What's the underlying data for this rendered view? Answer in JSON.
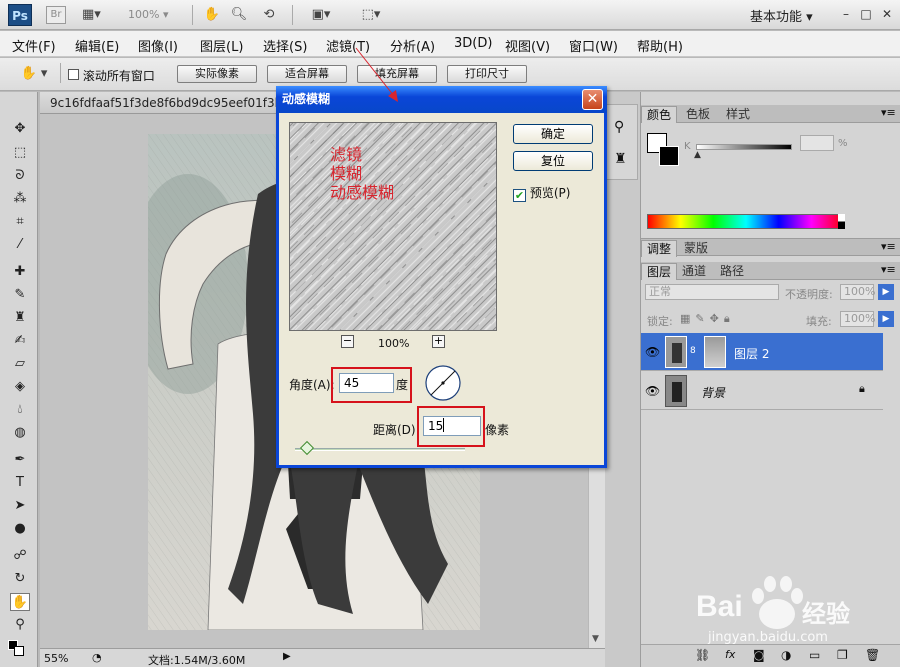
{
  "app": {
    "logo": "Ps",
    "bridge": "Br",
    "zoom_select": "100%",
    "workspace": "基本功能",
    "window_controls": [
      "–",
      "□",
      "✕"
    ]
  },
  "menu": [
    "文件(F)",
    "编辑(E)",
    "图像(I)",
    "图层(L)",
    "选择(S)",
    "滤镜(T)",
    "分析(A)",
    "3D(D)",
    "视图(V)",
    "窗口(W)",
    "帮助(H)"
  ],
  "options_bar": {
    "scroll_all_windows": "滚动所有窗口",
    "buttons": [
      "实际像素",
      "适合屏幕",
      "填充屏幕",
      "打印尺寸"
    ]
  },
  "document": {
    "tab_title": "9c16fdfaaf51f3de8f6bd9dc95eef01f3b29",
    "zoom": "55%",
    "doc_size": "文档:1.54M/3.60M"
  },
  "dialog": {
    "title": "动感模糊",
    "ok": "确定",
    "reset": "复位",
    "preview_label": "预览(P)",
    "preview_checked": true,
    "zoom_level": "100%",
    "zoom_minus": "−",
    "zoom_plus": "+",
    "angle_label": "角度(A):",
    "angle_value": "45",
    "angle_unit": "度",
    "distance_label": "距离(D):",
    "distance_value": "15",
    "distance_unit": "像素",
    "annotation_lines": [
      "滤镜",
      "模糊",
      "动感模糊"
    ]
  },
  "panels": {
    "color_tabs": [
      "颜色",
      "色板",
      "样式"
    ],
    "k_label": "K",
    "k_percent": "%",
    "adjust_tabs": [
      "调整",
      "蒙版"
    ],
    "layer_tabs": [
      "图层",
      "通道",
      "路径"
    ],
    "blend_mode": "正常",
    "opacity_label": "不透明度:",
    "opacity_value": "100%",
    "lock_label": "锁定:",
    "fill_label": "填充:",
    "fill_value": "100%",
    "layers": [
      {
        "name": "图层 2",
        "selected": true
      },
      {
        "name": "背景",
        "selected": false
      }
    ]
  },
  "watermark": {
    "brand": "Bai",
    "brand2": "经验",
    "url": "jingyan.baidu.com"
  },
  "colors": {
    "dialog_title": "#0a46d8",
    "annotation": "#d8252e",
    "layer_selected": "#3a6fd0"
  }
}
